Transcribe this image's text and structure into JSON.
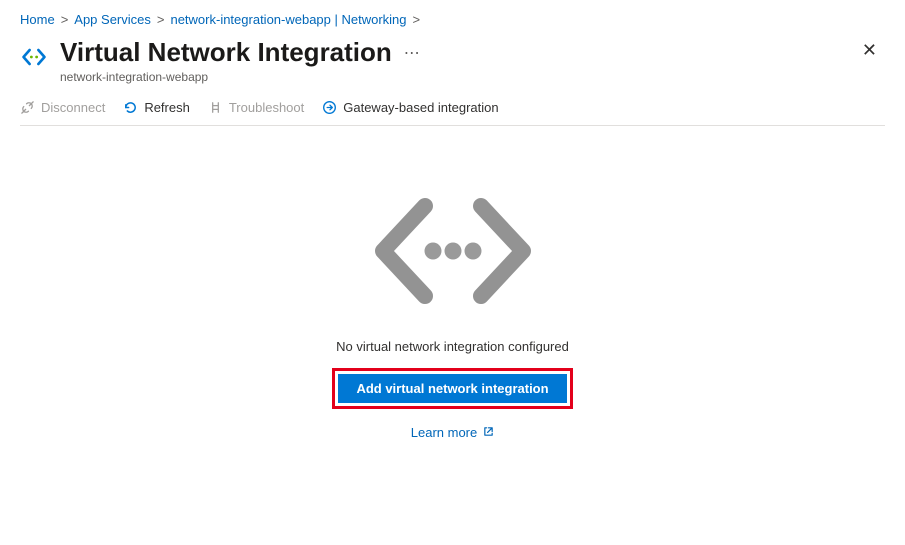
{
  "breadcrumb": {
    "items": [
      {
        "label": "Home"
      },
      {
        "label": "App Services"
      },
      {
        "label": "network-integration-webapp | Networking"
      }
    ]
  },
  "header": {
    "title": "Virtual Network Integration",
    "subtitle": "network-integration-webapp"
  },
  "toolbar": {
    "disconnect": "Disconnect",
    "refresh": "Refresh",
    "troubleshoot": "Troubleshoot",
    "gateway": "Gateway-based integration"
  },
  "empty": {
    "message": "No virtual network integration configured",
    "button": "Add virtual network integration",
    "learn_more": "Learn more"
  }
}
